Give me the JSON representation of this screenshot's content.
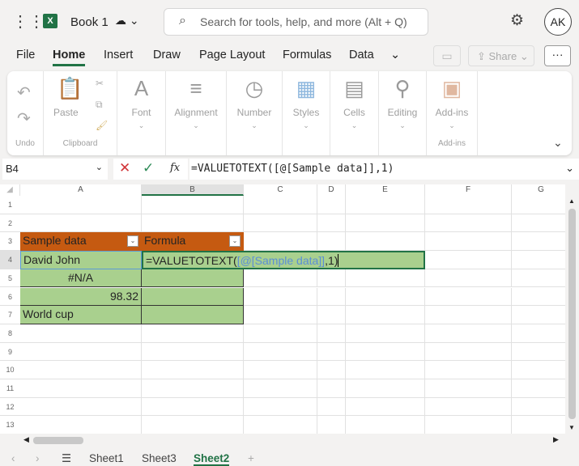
{
  "app": {
    "title": "Book 1",
    "search_placeholder": "Search for tools, help, and more (Alt + Q)",
    "avatar": "AK"
  },
  "menu": [
    "File",
    "Home",
    "Insert",
    "Draw",
    "Page Layout",
    "Formulas",
    "Data"
  ],
  "share_label": "Share",
  "ribbon": {
    "groups": [
      {
        "label": "",
        "group": "Undo"
      },
      {
        "label": "Paste",
        "group": "Clipboard"
      },
      {
        "label": "Font",
        "group": ""
      },
      {
        "label": "Alignment",
        "group": ""
      },
      {
        "label": "Number",
        "group": ""
      },
      {
        "label": "Styles",
        "group": ""
      },
      {
        "label": "Cells",
        "group": ""
      },
      {
        "label": "Editing",
        "group": ""
      },
      {
        "label": "Add-ins",
        "group": "Add-ins"
      }
    ]
  },
  "formula_bar": {
    "name_box": "B4",
    "fx": "fx",
    "formula": "=VALUETOTEXT([@[Sample data]],1)"
  },
  "columns": [
    "A",
    "B",
    "C",
    "D",
    "E",
    "F",
    "G"
  ],
  "rows": [
    "1",
    "2",
    "3",
    "4",
    "5",
    "6",
    "7",
    "8",
    "9",
    "10",
    "11",
    "12",
    "13"
  ],
  "table": {
    "headers": [
      "Sample data",
      "Formula"
    ],
    "col_a": [
      "David John",
      "#N/A",
      "98.32",
      "World cup"
    ],
    "edit": {
      "prefix": "=VALUETOTEXT(",
      "ref": "[@[Sample data]]",
      "suffix": ",1)"
    }
  },
  "sheets": [
    "Sheet1",
    "Sheet3",
    "Sheet2"
  ],
  "colors": {
    "header": "#c55a11",
    "fill": "#a9d08e",
    "accent": "#217346"
  }
}
